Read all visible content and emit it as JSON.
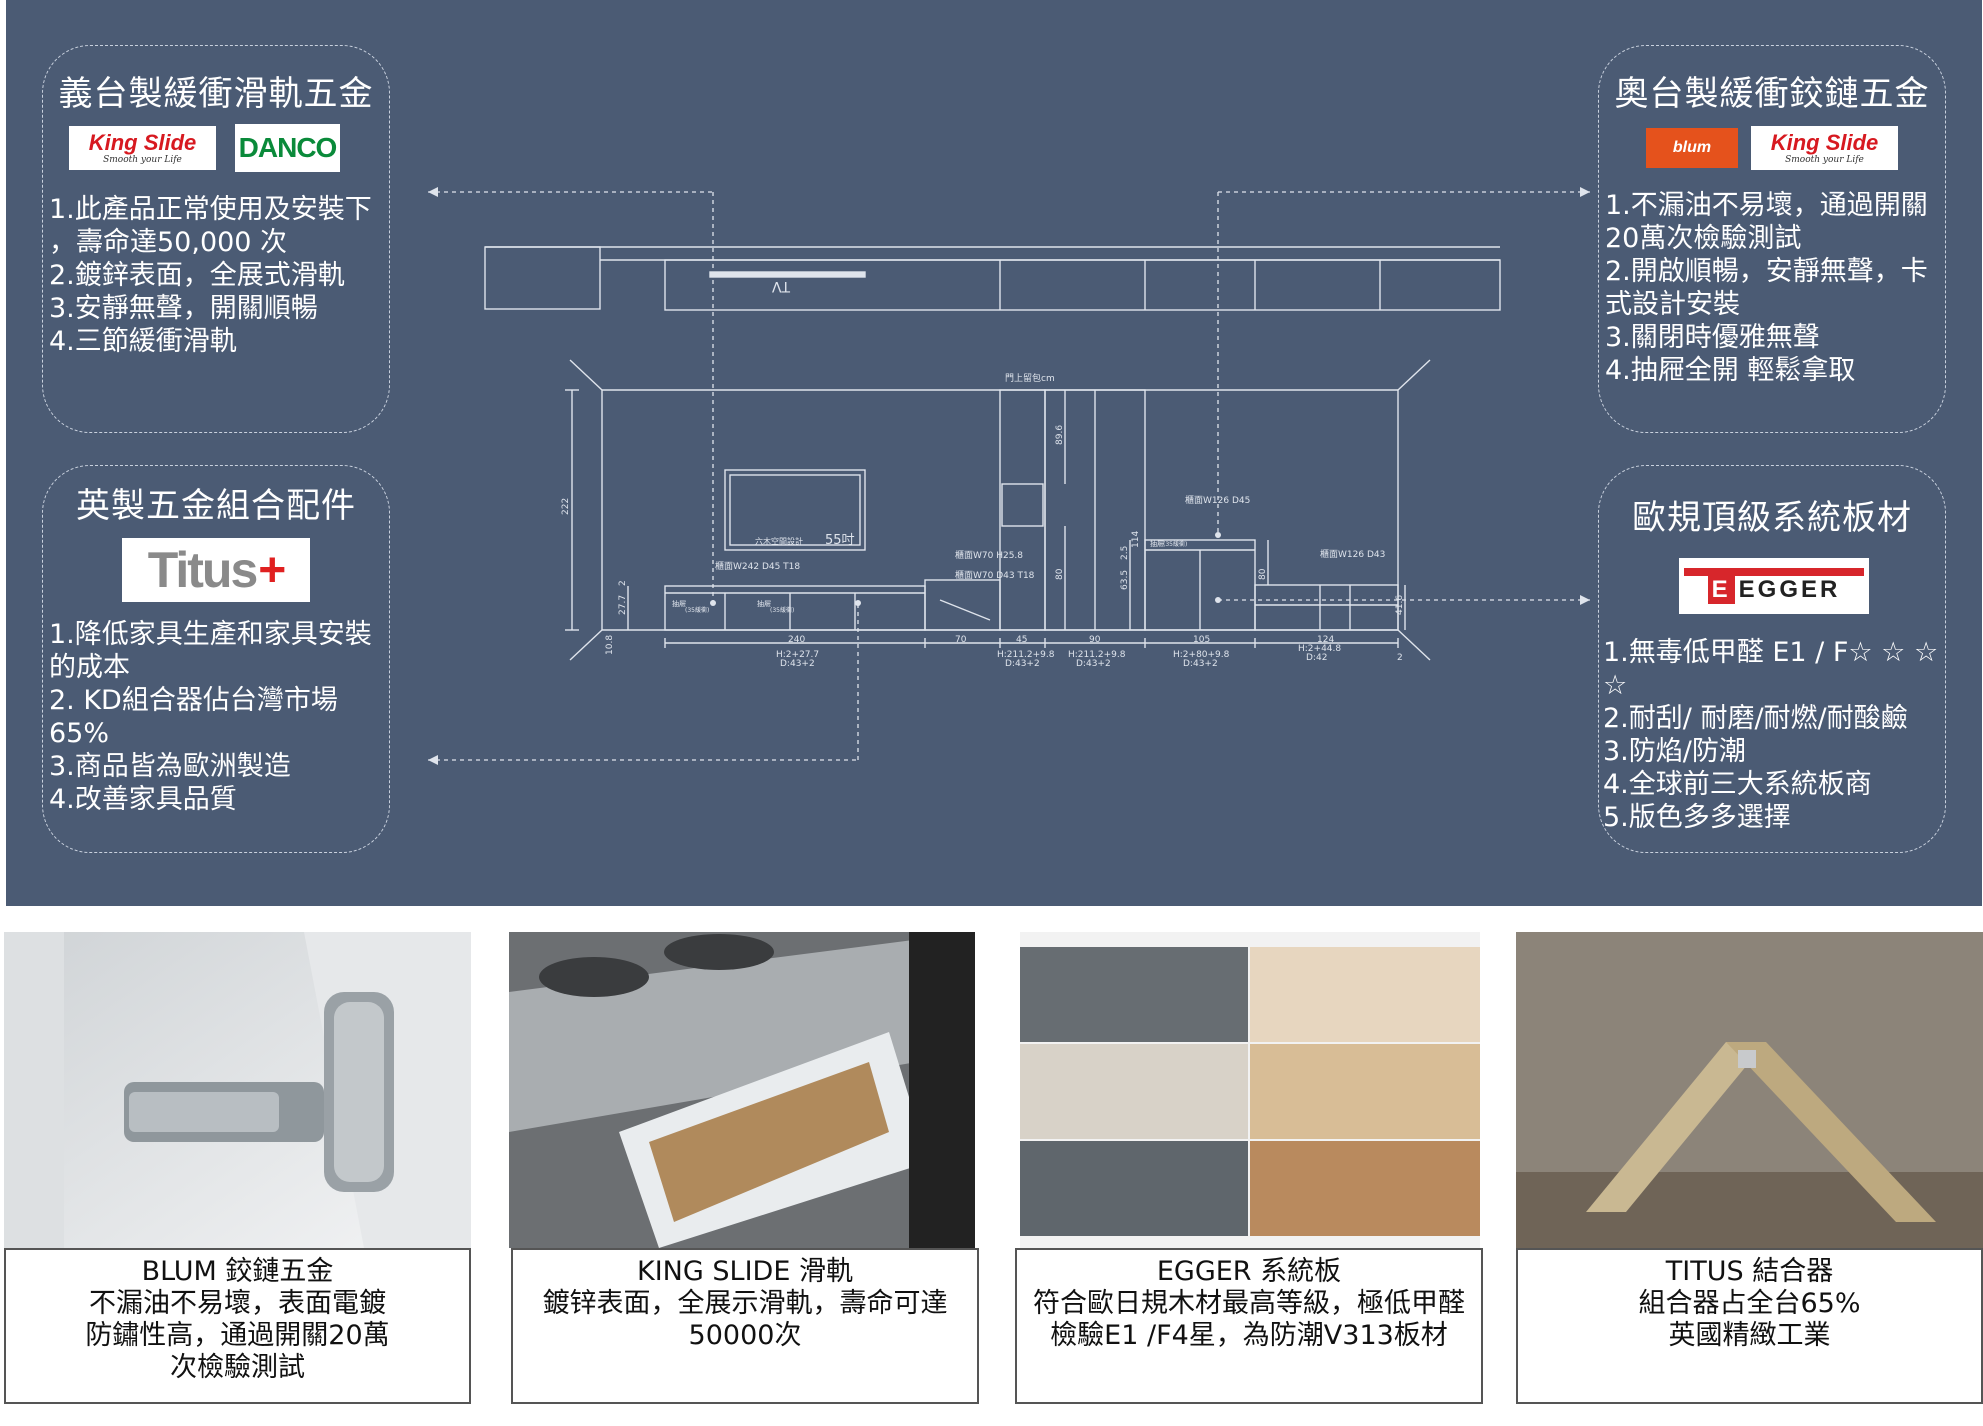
{
  "boxes": {
    "top_left": {
      "title": "義台製緩衝滑軌五金",
      "items": [
        "1.此產品正常使用及安裝下",
        "，壽命達50,000 次",
        "2.鍍鋅表面，全展式滑軌",
        "3.安靜無聲，開關順暢",
        "4.三節緩衝滑軌"
      ],
      "logos": {
        "kingslide": "King Slide",
        "kingslide_tagline": "Smooth your Life",
        "danco": "DANCO"
      }
    },
    "bottom_left": {
      "title": "英製五金組合配件",
      "items": [
        "1.降低家具生產和家具安裝",
        "的成本",
        "2. KD組合器佔台灣市場65%",
        "3.商品皆為歐洲製造",
        "4.改善家具品質"
      ],
      "logos": {
        "titus": "Titus",
        "titus_plus": "+"
      }
    },
    "top_right": {
      "title": "奧台製緩衝鉸鏈五金",
      "items": [
        "1.不漏油不易壞，通過開關",
        "20萬次檢驗測試",
        "2.開啟順暢，安靜無聲，卡",
        "式設計安裝",
        "3.關閉時優雅無聲",
        "4.抽屜全開 輕鬆拿取"
      ],
      "logos": {
        "blum": "blum",
        "kingslide": "King Slide",
        "kingslide_tagline": "Smooth your Life"
      }
    },
    "bottom_right": {
      "title": "歐規頂級系統板材",
      "items": [
        "1.無毒低甲醛 E1 / F☆ ☆ ☆ ☆",
        "2.耐刮/ 耐磨/耐燃/耐酸鹼",
        "3.防焰/防潮",
        "4.全球前三大系統板商",
        "5.版色多多選擇"
      ],
      "logos": {
        "egger_e": "E",
        "egger": "EGGER"
      }
    }
  },
  "drawing": {
    "tv_label": "TV",
    "tv_size": "55吋",
    "logo_text": "六木空間設計",
    "ceiling_note": "門上留包cm",
    "height_total": "222",
    "labels": {
      "cab1": "櫃面W242 D45 T18",
      "cab2": "櫃面W70 H25.8",
      "cab3": "櫃面W70 D43 T18",
      "cab4": "櫃面W126 D45",
      "cab5": "櫃面W126 D43",
      "drawer": "抽屜",
      "drawer_note": "(35緩衝)"
    },
    "dims_h": [
      "240",
      "70",
      "45",
      "90",
      "105",
      "124"
    ],
    "dims_v": [
      "89.6",
      "80",
      "2.5",
      "63.5",
      "114",
      "80",
      "41.6",
      "27.7",
      "2",
      "10.8"
    ],
    "notes": {
      "n1a": "H:2+27.7",
      "n1b": "D:43+2",
      "n2a": "H:211.2+9.8",
      "n2b": "D:43+2",
      "n3a": "H:211.2+9.8",
      "n3b": "D:43+2",
      "n4a": "H:2+80+9.8",
      "n4b": "D:43+2",
      "n5a": "H:2+44.8",
      "n5b": "D:42",
      "n6": "2"
    }
  },
  "products": [
    {
      "title": "BLUM 鉸鏈五金",
      "lines": [
        "不漏油不易壞，表面電鍍",
        "防鏽性高，通過開關20萬",
        "次檢驗測試"
      ]
    },
    {
      "title": "KING SLIDE 滑軌",
      "lines": [
        "鍍锌表面，全展示滑軌，壽命可達",
        "50000次"
      ]
    },
    {
      "title": "EGGER 系統板",
      "lines": [
        "符合歐日規木材最高等級，極低甲醛",
        "檢驗E1 /F4星，為防潮V313板材"
      ]
    },
    {
      "title": "TITUS 結合器",
      "lines": [
        "組合器占全台65%",
        "英國精緻工業"
      ]
    }
  ],
  "colors": {
    "panel": "#4b5b74",
    "line": "#d8dde6",
    "kingslide_red": "#d71920",
    "danco_green": "#0a8a3a",
    "blum_orange": "#e5521c",
    "egger_red": "#d7262b"
  }
}
